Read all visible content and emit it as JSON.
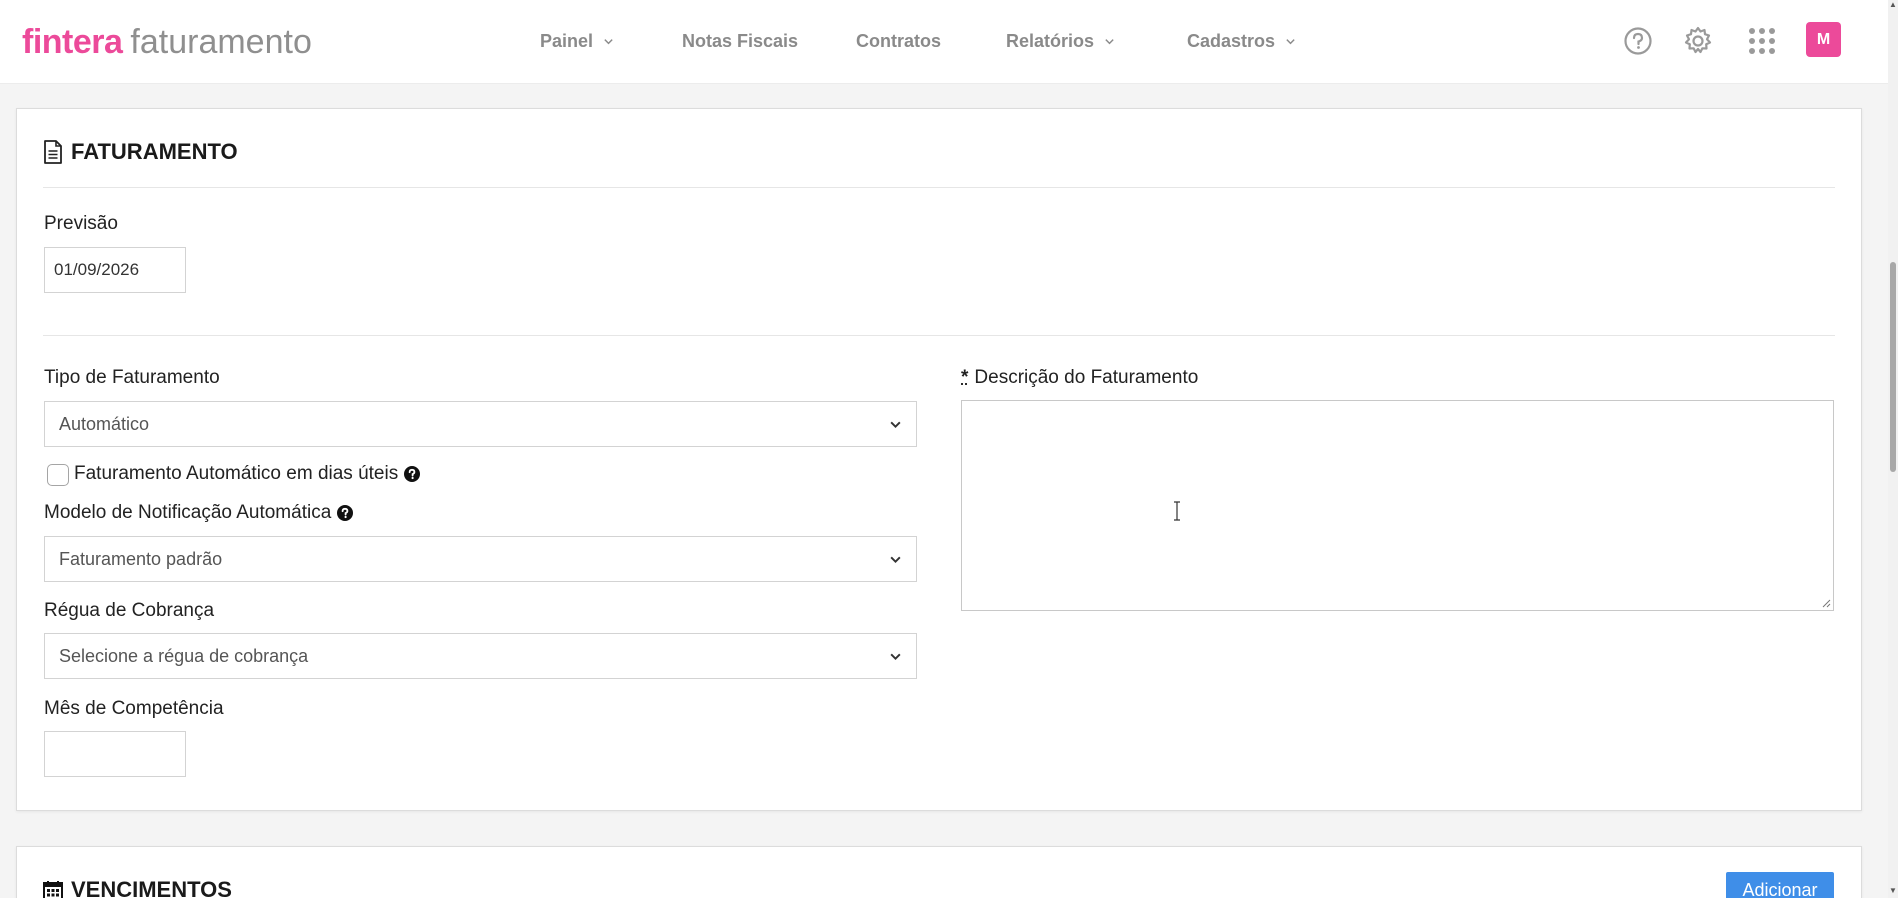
{
  "brand": {
    "primary": "fintera",
    "secondary": "faturamento"
  },
  "nav": {
    "items": [
      {
        "label": "Painel",
        "has_dropdown": true
      },
      {
        "label": "Notas Fiscais",
        "has_dropdown": false
      },
      {
        "label": "Contratos",
        "has_dropdown": false
      },
      {
        "label": "Relatórios",
        "has_dropdown": true
      },
      {
        "label": "Cadastros",
        "has_dropdown": true
      }
    ]
  },
  "toolbar": {
    "icons": [
      "help-circle-icon",
      "gear-icon",
      "apps-grid-icon"
    ],
    "avatar_initial": "M"
  },
  "colors": {
    "brand": "#ec4a9a",
    "accent": "#3f8ee8",
    "nav_text": "#8a8a8a"
  },
  "faturamento": {
    "title": "FATURAMENTO",
    "previsao": {
      "label": "Previsão",
      "value": "01/09/2026"
    },
    "tipo": {
      "label": "Tipo de Faturamento",
      "selected": "Automático"
    },
    "dias_uteis": {
      "label": "Faturamento Automático em dias úteis",
      "checked": false
    },
    "modelo_notificacao": {
      "label": "Modelo de Notificação Automática",
      "selected": "Faturamento padrão"
    },
    "regua": {
      "label": "Régua de Cobrança",
      "selected": "Selecione a régua de cobrança"
    },
    "mes_competencia": {
      "label": "Mês de Competência",
      "value": ""
    },
    "descricao": {
      "required_mark": "*",
      "label": "Descrição do Faturamento",
      "value": ""
    }
  },
  "vencimentos": {
    "title": "VENCIMENTOS",
    "add_label": "Adicionar"
  }
}
